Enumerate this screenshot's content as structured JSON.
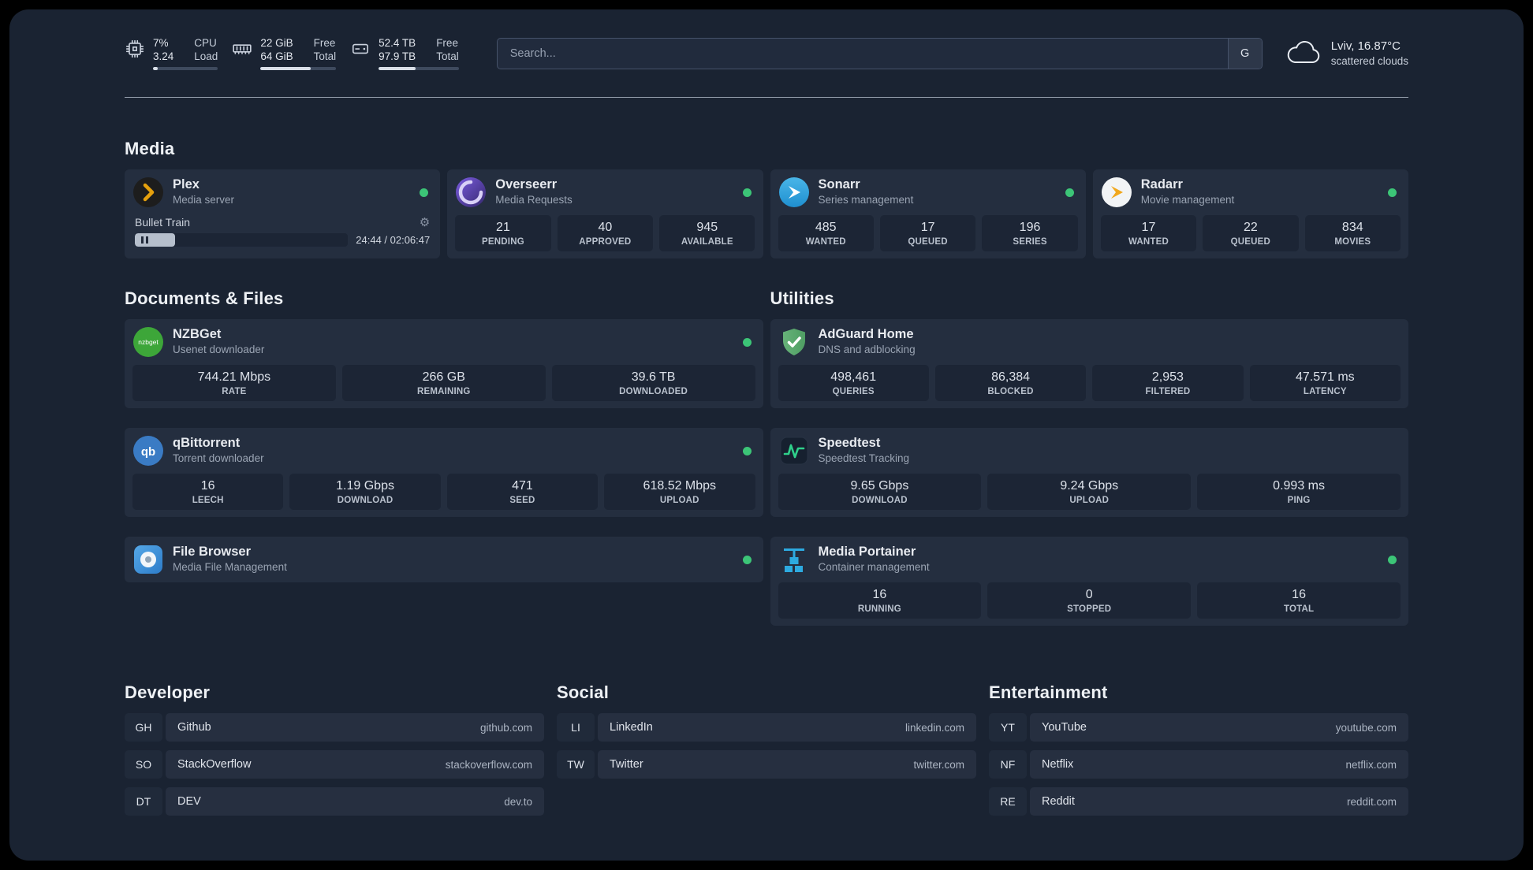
{
  "topbar": {
    "cpu": {
      "value_top": "7%",
      "value_bottom": "3.24",
      "label_top": "CPU",
      "label_bottom": "Load",
      "fill": 7
    },
    "ram": {
      "value_top": "22 GiB",
      "value_bottom": "64 GiB",
      "label_top": "Free",
      "label_bottom": "Total",
      "fill": 66
    },
    "disk": {
      "value_top": "52.4 TB",
      "value_bottom": "97.9 TB",
      "label_top": "Free",
      "label_bottom": "Total",
      "fill": 46
    },
    "search": {
      "placeholder": "Search...",
      "provider": "G"
    },
    "weather": {
      "primary": "Lviv, 16.87°C",
      "secondary": "scattered clouds"
    }
  },
  "media": {
    "title": "Media",
    "plex": {
      "name": "Plex",
      "desc": "Media server",
      "now_playing": "Bullet Train",
      "time": "24:44 / 02:06:47",
      "progress": 19
    },
    "overseerr": {
      "name": "Overseerr",
      "desc": "Media Requests",
      "stats": [
        {
          "value": "21",
          "label": "PENDING"
        },
        {
          "value": "40",
          "label": "APPROVED"
        },
        {
          "value": "945",
          "label": "AVAILABLE"
        }
      ]
    },
    "sonarr": {
      "name": "Sonarr",
      "desc": "Series management",
      "stats": [
        {
          "value": "485",
          "label": "WANTED"
        },
        {
          "value": "17",
          "label": "QUEUED"
        },
        {
          "value": "196",
          "label": "SERIES"
        }
      ]
    },
    "radarr": {
      "name": "Radarr",
      "desc": "Movie management",
      "stats": [
        {
          "value": "17",
          "label": "WANTED"
        },
        {
          "value": "22",
          "label": "QUEUED"
        },
        {
          "value": "834",
          "label": "MOVIES"
        }
      ]
    }
  },
  "documents": {
    "title": "Documents & Files",
    "nzbget": {
      "name": "NZBGet",
      "desc": "Usenet downloader",
      "stats": [
        {
          "value": "744.21 Mbps",
          "label": "RATE"
        },
        {
          "value": "266 GB",
          "label": "REMAINING"
        },
        {
          "value": "39.6 TB",
          "label": "DOWNLOADED"
        }
      ]
    },
    "qbittorrent": {
      "name": "qBittorrent",
      "desc": "Torrent downloader",
      "stats": [
        {
          "value": "16",
          "label": "LEECH"
        },
        {
          "value": "1.19 Gbps",
          "label": "DOWNLOAD"
        },
        {
          "value": "471",
          "label": "SEED"
        },
        {
          "value": "618.52 Mbps",
          "label": "UPLOAD"
        }
      ]
    },
    "filebrowser": {
      "name": "File Browser",
      "desc": "Media File Management"
    }
  },
  "utilities": {
    "title": "Utilities",
    "adguard": {
      "name": "AdGuard Home",
      "desc": "DNS and adblocking",
      "stats": [
        {
          "value": "498,461",
          "label": "QUERIES"
        },
        {
          "value": "86,384",
          "label": "BLOCKED"
        },
        {
          "value": "2,953",
          "label": "FILTERED"
        },
        {
          "value": "47.571 ms",
          "label": "LATENCY"
        }
      ]
    },
    "speedtest": {
      "name": "Speedtest",
      "desc": "Speedtest Tracking",
      "stats": [
        {
          "value": "9.65 Gbps",
          "label": "DOWNLOAD"
        },
        {
          "value": "9.24 Gbps",
          "label": "UPLOAD"
        },
        {
          "value": "0.993 ms",
          "label": "PING"
        }
      ]
    },
    "portainer": {
      "name": "Media Portainer",
      "desc": "Container management",
      "stats": [
        {
          "value": "16",
          "label": "RUNNING"
        },
        {
          "value": "0",
          "label": "STOPPED"
        },
        {
          "value": "16",
          "label": "TOTAL"
        }
      ]
    }
  },
  "bookmarks": {
    "developer": {
      "title": "Developer",
      "items": [
        {
          "abbr": "GH",
          "name": "Github",
          "url": "github.com"
        },
        {
          "abbr": "SO",
          "name": "StackOverflow",
          "url": "stackoverflow.com"
        },
        {
          "abbr": "DT",
          "name": "DEV",
          "url": "dev.to"
        }
      ]
    },
    "social": {
      "title": "Social",
      "items": [
        {
          "abbr": "LI",
          "name": "LinkedIn",
          "url": "linkedin.com"
        },
        {
          "abbr": "TW",
          "name": "Twitter",
          "url": "twitter.com"
        }
      ]
    },
    "entertainment": {
      "title": "Entertainment",
      "items": [
        {
          "abbr": "YT",
          "name": "YouTube",
          "url": "youtube.com"
        },
        {
          "abbr": "NF",
          "name": "Netflix",
          "url": "netflix.com"
        },
        {
          "abbr": "RE",
          "name": "Reddit",
          "url": "reddit.com"
        }
      ]
    }
  },
  "colors": {
    "status_green": "#3cc577",
    "plex_gold": "#e5a00d",
    "background": "#1a2332"
  }
}
